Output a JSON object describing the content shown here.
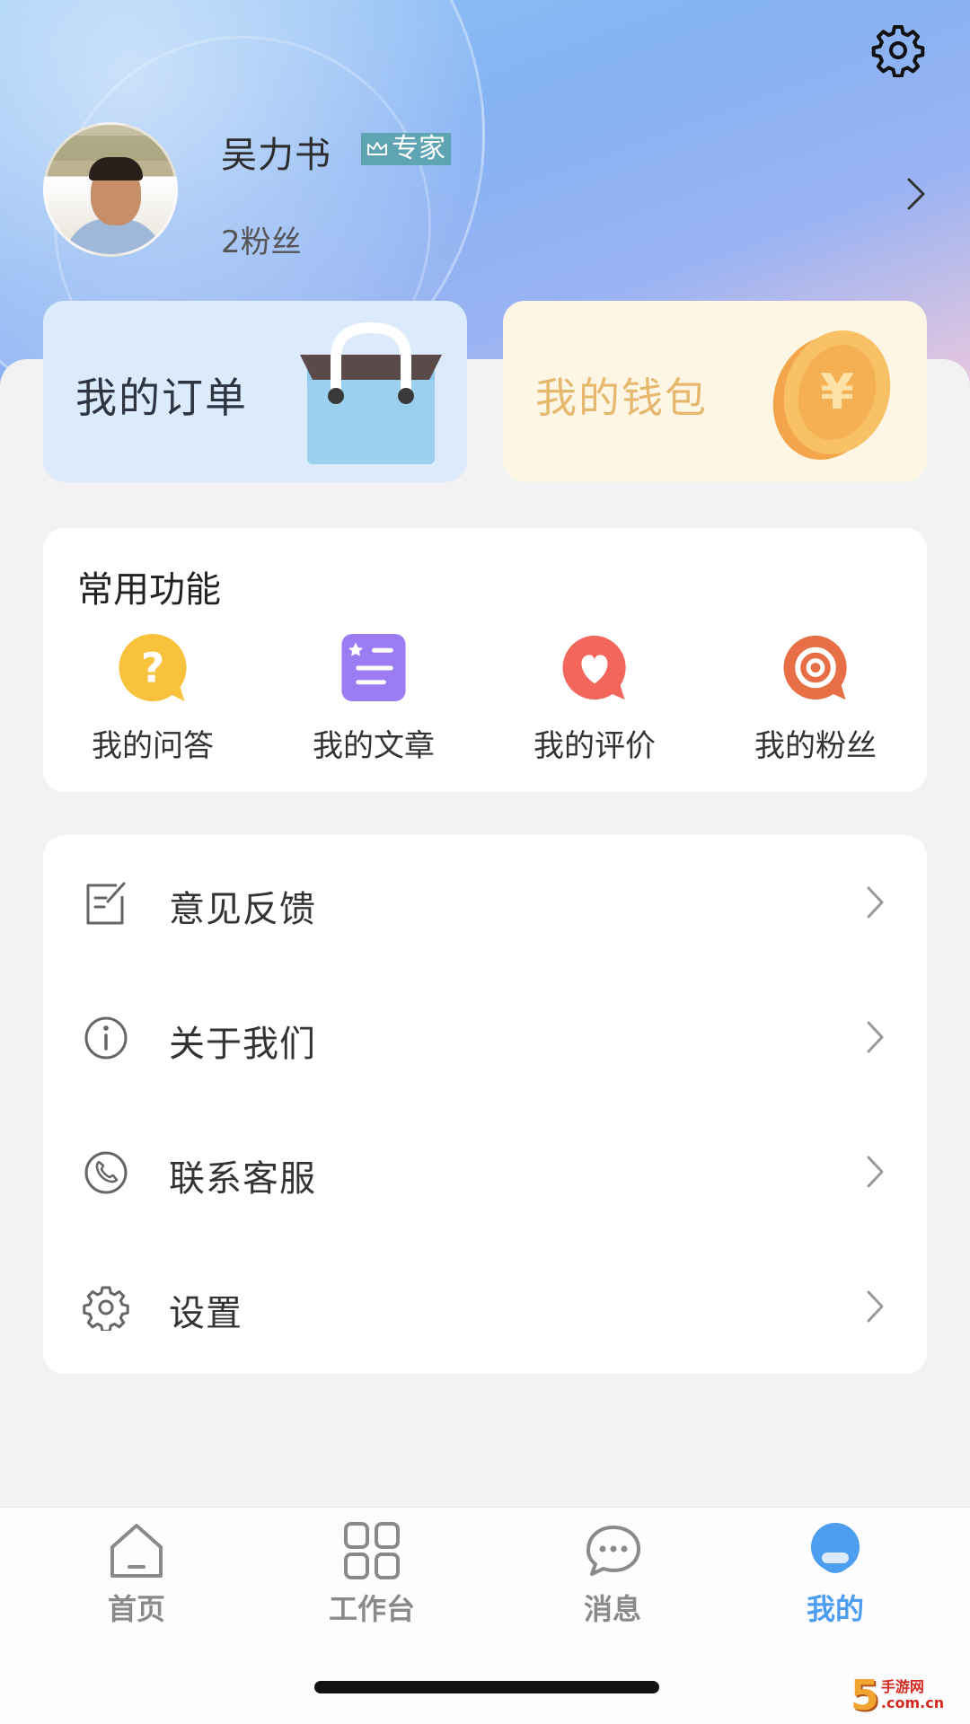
{
  "header": {
    "user_name": "吴力书",
    "badge_label": "专家",
    "fans_text": "2粉丝"
  },
  "cards": {
    "orders_label": "我的订单",
    "wallet_label": "我的钱包",
    "wallet_symbol": "¥"
  },
  "common_functions": {
    "title": "常用功能",
    "items": [
      {
        "label": "我的问答",
        "icon": "question-icon",
        "color": "#f9c23c"
      },
      {
        "label": "我的文章",
        "icon": "article-icon",
        "color": "#9b7cf2"
      },
      {
        "label": "我的评价",
        "icon": "heart-chat-icon",
        "color": "#f2665b"
      },
      {
        "label": "我的粉丝",
        "icon": "target-icon",
        "color": "#e86f45"
      }
    ]
  },
  "menu": {
    "items": [
      {
        "label": "意见反馈",
        "icon": "feedback-icon"
      },
      {
        "label": "关于我们",
        "icon": "info-icon"
      },
      {
        "label": "联系客服",
        "icon": "phone-icon"
      },
      {
        "label": "设置",
        "icon": "gear-icon"
      }
    ]
  },
  "tabbar": {
    "items": [
      {
        "label": "首页",
        "icon": "home-icon",
        "active": false
      },
      {
        "label": "工作台",
        "icon": "grid-icon",
        "active": false
      },
      {
        "label": "消息",
        "icon": "chat-icon",
        "active": false
      },
      {
        "label": "我的",
        "icon": "profile-icon",
        "active": true
      }
    ],
    "active_color": "#4d9df0",
    "inactive_color": "#8a8a8a"
  },
  "watermark": {
    "number": "5",
    "line1": "手游网",
    "line2": ".com.cn"
  }
}
